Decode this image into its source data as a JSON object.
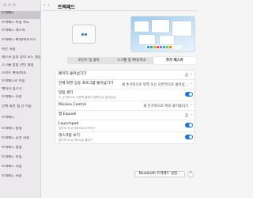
{
  "window": {
    "title": "트랙패드"
  },
  "colors": {
    "accent": "#1a73e8",
    "sidebar_bg": "#ebe9ec",
    "selected_bg": "#c9c6cc"
  },
  "sidebar": {
    "items": [
      {
        "label": "트랙패드",
        "sub": ""
      },
      {
        "label": "트랙패드 이동 속도",
        "sub": ""
      },
      {
        "label": "트랙패드 제스처",
        "sub": ""
      },
      {
        "label": "트랙패드 확대/축소하기",
        "sub": ""
      },
      {
        "label": "아은 사용",
        "sub": ""
      },
      {
        "label": "제스처 등의 동작 모드 설정",
        "sub": ""
      },
      {
        "label": "스크롤 방향 관련 설정",
        "sub": ""
      },
      {
        "label": "스마트 확대/축소",
        "sub": ""
      },
      {
        "label": "트랙패드로 이동",
        "sub": ""
      },
      {
        "label": "페이지 넘기기",
        "sub": ""
      },
      {
        "label": "트랙패드 사용",
        "sub": ""
      },
      {
        "label": "전체 화면 앱 간 이동",
        "sub": ""
      },
      {
        "label": "트랙패드",
        "sub": ""
      },
      {
        "label": "트랙패드 설정",
        "sub": ""
      },
      {
        "label": "트랙패드 공유 사용",
        "sub": ""
      },
      {
        "label": "트랙패드 설정",
        "sub": ""
      },
      {
        "label": "트랙패드 이동",
        "sub": ""
      },
      {
        "label": "트랙패드 사용",
        "sub": ""
      },
      {
        "label": "트랙패드 사용",
        "sub": ""
      }
    ]
  },
  "tabs": [
    {
      "label": "포인트 및 클릭"
    },
    {
      "label": "스크롤 및 확대/축소"
    },
    {
      "label": "추가 제스처"
    }
  ],
  "rows": [
    {
      "label": "페이지 쓸어넘기기",
      "sub": "",
      "value": "끔",
      "control": "chevron"
    },
    {
      "label": "전체 화면 응용 프로그램 쓸어넘기기",
      "sub": "",
      "value": "세 손가락으로 왼쪽 또는 오른쪽으로 쓸어넘…",
      "control": "chevron"
    },
    {
      "label": "알림 센터",
      "sub": "두 손가락으로 오른쪽 끝에서 왼쪽으로 쓸어넘김",
      "value": "",
      "control": "toggle"
    },
    {
      "label": "Mission Control",
      "sub": "",
      "value": "세 손가락으로 위로 쓸어올리기",
      "control": "chevron"
    },
    {
      "label": "앱 Exposé",
      "sub": "",
      "value": "끔",
      "control": "chevron"
    },
    {
      "label": "Launchpad",
      "sub": "엄지와 세 손가락으로 오므리기",
      "value": "",
      "control": "toggle"
    },
    {
      "label": "데스크탑 보기",
      "sub": "엄지와 세 손가락으로 펼치기",
      "value": "",
      "control": "toggle"
    }
  ],
  "buttons": {
    "bluetooth": "Bluetooth 트랙패드 설정...",
    "help": "?"
  },
  "icons": {
    "back": "chevron-left-icon",
    "forward": "chevron-right-icon",
    "chevron": "chevron-updown-icon"
  }
}
